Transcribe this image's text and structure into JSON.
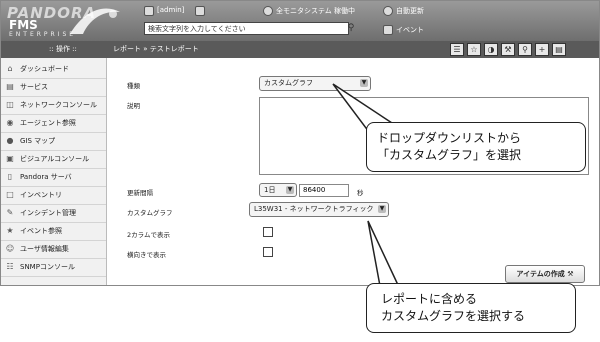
{
  "logo": {
    "line1": "PANDORA",
    "line2": "FMS",
    "line3": "ENTERPRISE"
  },
  "header": {
    "user": "[admin]",
    "monitor_status": "全モニタシステム 稼働中",
    "auto_refresh": "自動更新",
    "events": "イベント",
    "search_placeholder": "検索文字列を入力してください"
  },
  "subbar": {
    "ops_label": "操作",
    "breadcrumb": "レポート » テストレポート",
    "toolbar_icons": [
      "list-icon",
      "star-icon",
      "chart-icon",
      "wrench-icon",
      "key-icon",
      "plus-icon",
      "document-icon"
    ]
  },
  "sidebar": {
    "items": [
      {
        "label": "ダッシュボード",
        "icon": "dashboard-icon"
      },
      {
        "label": "サービス",
        "icon": "service-icon"
      },
      {
        "label": "ネットワークコンソール",
        "icon": "network-icon"
      },
      {
        "label": "エージェント参照",
        "icon": "agent-icon"
      },
      {
        "label": "GIS マップ",
        "icon": "globe-icon"
      },
      {
        "label": "ビジュアルコンソール",
        "icon": "visual-console-icon"
      },
      {
        "label": "Pandora サーバ",
        "icon": "server-icon"
      },
      {
        "label": "インベントリ",
        "icon": "inventory-icon"
      },
      {
        "label": "インシデント管理",
        "icon": "incident-icon"
      },
      {
        "label": "イベント参照",
        "icon": "event-icon"
      },
      {
        "label": "ユーザ情報編集",
        "icon": "user-icon"
      },
      {
        "label": "SNMPコンソール",
        "icon": "snmp-icon"
      }
    ]
  },
  "form": {
    "type_label": "種類",
    "type_value": "カスタムグラフ",
    "description_label": "説明",
    "period_label": "更新間隔",
    "period_unit": "1日",
    "period_seconds": "86400",
    "period_suffix": "秒",
    "custom_graph_label": "カスタムグラフ",
    "custom_graph_value": "L35W31 - ネットワークトラフィック",
    "two_column_label": "2カラムで表示",
    "horizontal_label": "横向きで表示",
    "create_button": "アイテムの作成"
  },
  "callouts": {
    "top": [
      "ドロップダウンリストから",
      "「カスタムグラフ」を選択"
    ],
    "bottom": [
      "レポートに含める",
      "カスタムグラフを選択する"
    ]
  }
}
